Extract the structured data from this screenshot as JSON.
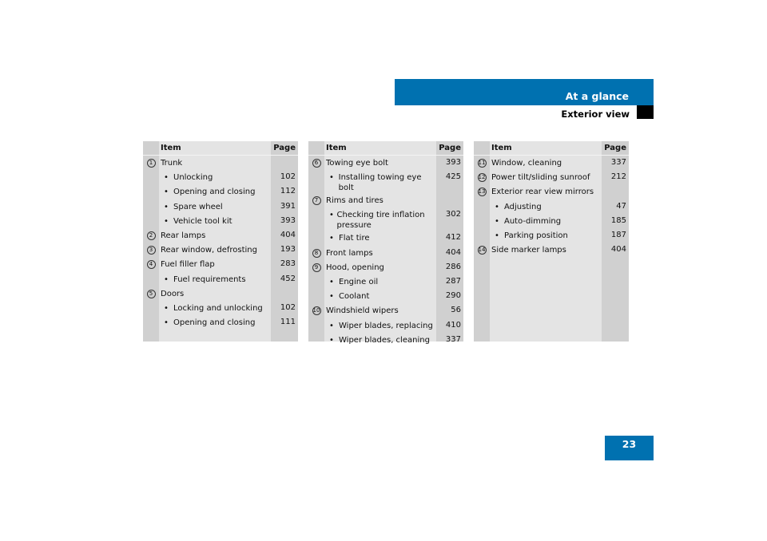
{
  "header": {
    "section": "At a glance",
    "subsection": "Exterior view"
  },
  "page_number": "23",
  "columns": {
    "item": "Item",
    "page": "Page"
  },
  "tables": [
    {
      "rows": [
        {
          "num": "1",
          "label": "Trunk",
          "page": ""
        },
        {
          "bullet": true,
          "label": "Unlocking",
          "page": "102"
        },
        {
          "bullet": true,
          "label": "Opening and closing",
          "page": "112"
        },
        {
          "bullet": true,
          "label": "Spare wheel",
          "page": "391"
        },
        {
          "bullet": true,
          "label": "Vehicle tool kit",
          "page": "393"
        },
        {
          "num": "2",
          "label": "Rear lamps",
          "page": "404"
        },
        {
          "num": "3",
          "label": "Rear window, defrosting",
          "page": "193"
        },
        {
          "num": "4",
          "label": "Fuel filler flap",
          "page": "283"
        },
        {
          "bullet": true,
          "label": "Fuel requirements",
          "page": "452"
        },
        {
          "num": "5",
          "label": "Doors",
          "page": ""
        },
        {
          "bullet": true,
          "label": "Locking and unlocking",
          "page": "102"
        },
        {
          "bullet": true,
          "label": "Opening and closing",
          "page": "111"
        }
      ]
    },
    {
      "rows": [
        {
          "num": "6",
          "label": "Towing eye bolt",
          "page": "393"
        },
        {
          "bullet": true,
          "label": "Installing towing eye bolt",
          "page": "425"
        },
        {
          "num": "7",
          "label": "Rims and tires",
          "page": ""
        },
        {
          "bullet": true,
          "label": "Checking tire inflation pressure",
          "page": "302"
        },
        {
          "bullet": true,
          "label": "Flat tire",
          "page": "412"
        },
        {
          "num": "8",
          "label": "Front lamps",
          "page": "404"
        },
        {
          "num": "9",
          "label": "Hood, opening",
          "page": "286"
        },
        {
          "bullet": true,
          "label": "Engine oil",
          "page": "287"
        },
        {
          "bullet": true,
          "label": "Coolant",
          "page": "290"
        },
        {
          "num": "10",
          "label": "Windshield wipers",
          "page": "56"
        },
        {
          "bullet": true,
          "label": "Wiper blades, replacing",
          "page": "410"
        },
        {
          "bullet": true,
          "label": "Wiper blades, cleaning",
          "page": "337"
        }
      ]
    },
    {
      "rows": [
        {
          "num": "11",
          "label": "Window, cleaning",
          "page": "337"
        },
        {
          "num": "12",
          "label": "Power tilt/sliding sunroof",
          "page": "212"
        },
        {
          "num": "13",
          "label": "Exterior rear view mirrors",
          "page": ""
        },
        {
          "bullet": true,
          "label": "Adjusting",
          "page": "47"
        },
        {
          "bullet": true,
          "label": "Auto-dimming",
          "page": "185"
        },
        {
          "bullet": true,
          "label": "Parking position",
          "page": "187"
        },
        {
          "num": "14",
          "label": "Side marker lamps",
          "page": "404"
        }
      ]
    }
  ],
  "colors": {
    "brand_blue": "#0071b0",
    "table_bg": "#e4e4e4",
    "column_bg": "#d0d0d0"
  }
}
